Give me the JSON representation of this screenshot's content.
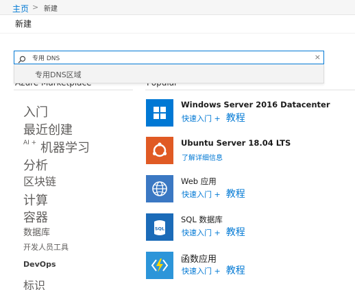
{
  "breadcrumb": {
    "home": "主页",
    "separator": ">",
    "current": "新建"
  },
  "page": {
    "title": "新建"
  },
  "search": {
    "value": "专用 DNS",
    "clear_glyph": "×",
    "suggestion": "专用DNS区域"
  },
  "marketplace": {
    "heading": "Azure Marketplace",
    "categories": [
      "入门",
      "最近创建",
      "机器学习",
      "分析",
      "区块链",
      "计算",
      "容器",
      "数据库",
      "开发人员工具",
      "DevOps",
      "标识"
    ],
    "ai_prefix": "AI +"
  },
  "popular": {
    "heading": "Popular",
    "items": [
      {
        "name": "Windows Server 2016 Datacenter",
        "link1": "快速入门 +",
        "link2": "教程",
        "icon": "windows-icon",
        "color": "#0078d4"
      },
      {
        "name": "Ubuntu Server 18.04 LTS",
        "link1": "了解详细信息",
        "icon": "ubuntu-icon",
        "color": "#e05a24"
      },
      {
        "name": "Web 应用",
        "link1": "快速入门 +",
        "link2": "教程",
        "icon": "web-app-icon",
        "color": "#3b78c3"
      },
      {
        "name": "SQL 数据库",
        "link1": "快速入门 +",
        "link2": "教程",
        "icon": "sql-database-icon",
        "color": "#1b6bb8"
      },
      {
        "name": "函数应用",
        "link1": "快速入门 +",
        "link2": "教程",
        "icon": "function-app-icon",
        "color": "#2c95d9"
      }
    ]
  },
  "colors": {
    "accent": "#0078d4",
    "ubuntu": "#e05a24"
  }
}
